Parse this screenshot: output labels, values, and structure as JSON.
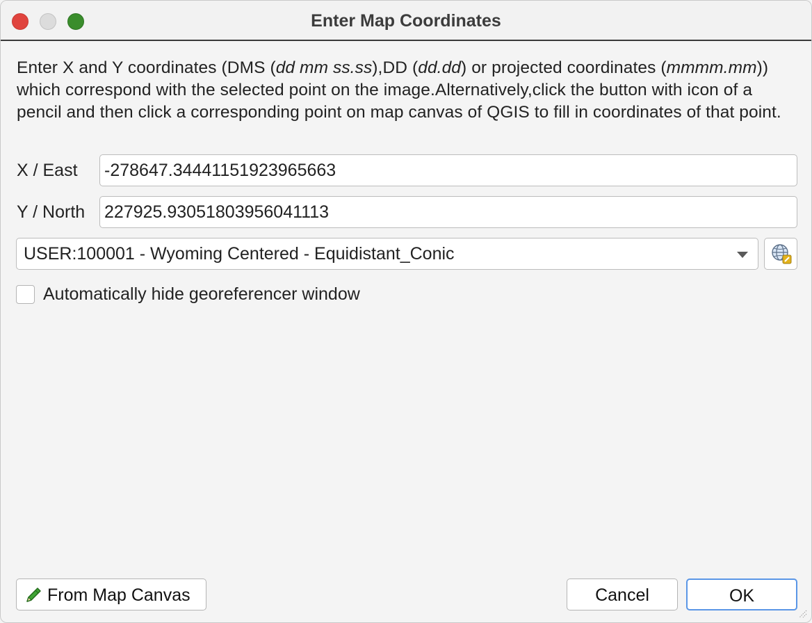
{
  "window": {
    "title": "Enter Map Coordinates"
  },
  "description": {
    "part1": "Enter X and Y coordinates (DMS (",
    "dms_format": "dd mm ss.ss",
    "part2": "),DD (",
    "dd_format": "dd.dd",
    "part3": ") or projected coordinates (",
    "projected_format": "mmmm.mm",
    "part4": ")) which correspond with the selected point on the image.Alternatively,click the button with icon of a pencil and then click a corresponding point on map canvas of QGIS to fill in coordinates of that point."
  },
  "fields": {
    "x_label": "X / East",
    "x_value": "-278647.34441151923965663",
    "y_label": "Y / North",
    "y_value": "227925.93051803956041113"
  },
  "crs": {
    "selected": "USER:100001 - Wyoming Centered - Equidistant_Conic",
    "selector_icon": "globe-crs-icon"
  },
  "options": {
    "auto_hide_label": "Automatically hide georeferencer window",
    "auto_hide_checked": false
  },
  "buttons": {
    "from_map_canvas": "From Map Canvas",
    "from_map_canvas_icon": "pencil-icon",
    "cancel": "Cancel",
    "ok": "OK"
  },
  "colors": {
    "close": "#e0443e",
    "minimize": "#dcdcdc",
    "zoom": "#3a8d2c",
    "default_button_border": "#5a96e6"
  }
}
